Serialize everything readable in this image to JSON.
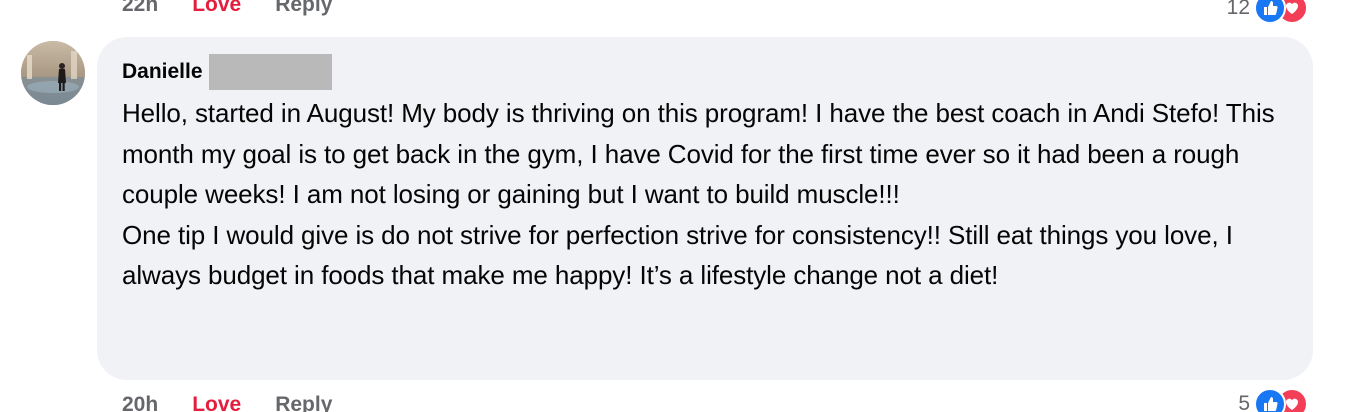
{
  "previous_comment": {
    "time": "22h",
    "love_label": "Love",
    "reply_label": "Reply",
    "reaction_count": "12",
    "reaction_icons": [
      "like-icon",
      "love-icon"
    ]
  },
  "comment": {
    "author": "Danielle",
    "author_surname_redacted": true,
    "paragraphs": [
      "Hello, started in August! My body is thriving on this program! I have the best coach in Andi Stefo! This month my goal is to get back in the gym, I have Covid for the first time ever so it had been a rough couple weeks! I am not losing or gaining but I want to build muscle!!!",
      "One tip I would give is do not strive for perfection strive for consistency!! Still eat things you love, I always budget in foods that make me happy! It’s a lifestyle change not a diet!"
    ],
    "time": "20h",
    "love_label": "Love",
    "reply_label": "Reply",
    "reaction_count": "5",
    "reaction_icons": [
      "like-icon",
      "love-icon"
    ]
  },
  "colors": {
    "bubble": "#f0f2f5",
    "love": "#e41e3f",
    "like_badge": "#1877f2",
    "love_badge": "#f33e58",
    "muted_text": "#65676b"
  }
}
